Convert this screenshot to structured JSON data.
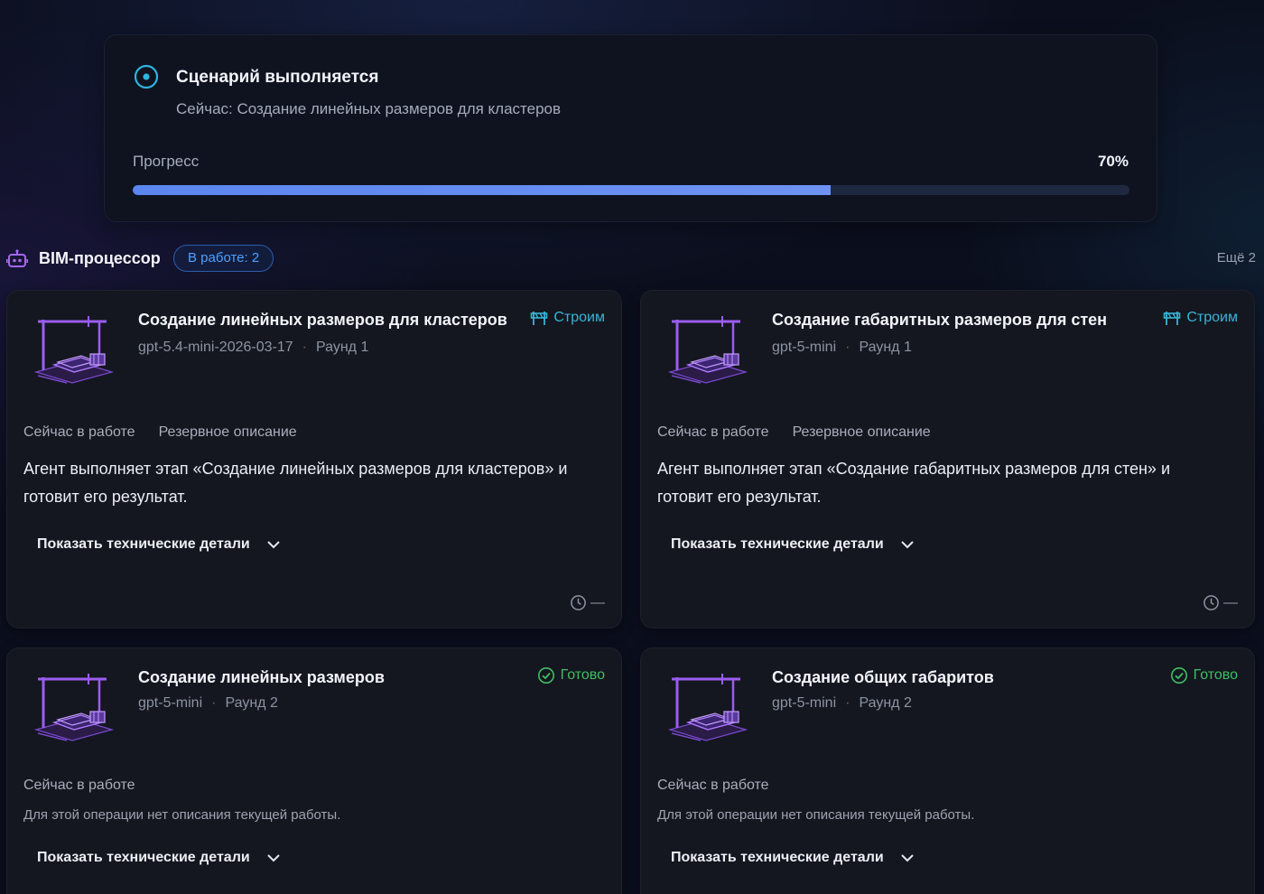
{
  "scenario": {
    "title": "Сценарий выполняется",
    "current": "Сейчас: Создание линейных размеров для кластеров",
    "progress_label": "Прогресс",
    "progress_value": "70%",
    "progress_fraction": 0.7,
    "accent": "#5b86ef"
  },
  "section": {
    "name": "BIM-процессор",
    "badge": "В работе: 2",
    "more": "Ещё 2"
  },
  "cards": [
    {
      "title": "Создание линейных размеров для кластеров",
      "model": "gpt-5.4-mini-2026-03-17",
      "dot": "·",
      "round": "Раунд 1",
      "status": "Строим",
      "status_icon": "building-icon",
      "label_now": "Сейчас в работе",
      "label_backup": "Резервное описание",
      "description": "Агент выполняет этап «Создание линейных размеров для кластеров» и готовит его результат.",
      "details": "Показать технические детали",
      "timer": "—"
    },
    {
      "title": "Создание габаритных размеров для стен",
      "model": "gpt-5-mini",
      "dot": "·",
      "round": "Раунд 1",
      "status": "Строим",
      "status_icon": "building-icon",
      "label_now": "Сейчас в работе",
      "label_backup": "Резервное описание",
      "description": "Агент выполняет этап «Создание габаритных размеров для стен» и готовит его результат.",
      "details": "Показать технические детали",
      "timer": "—"
    },
    {
      "title": "Создание линейных размеров",
      "model": "gpt-5-mini",
      "dot": "·",
      "round": "Раунд 2",
      "status": "Готово",
      "status_icon": "check-circle-icon",
      "label_now": "Сейчас в работе",
      "description": "Для этой операции нет описания текущей работы.",
      "details": "Показать технические детали"
    },
    {
      "title": "Создание общих габаритов",
      "model": "gpt-5-mini",
      "dot": "·",
      "round": "Раунд 2",
      "status": "Готово",
      "status_icon": "check-circle-icon",
      "label_now": "Сейчас в работе",
      "description": "Для этой операции нет описания текущей работы.",
      "details": "Показать технические детали"
    }
  ],
  "colors": {
    "building": "#37b5d8",
    "done": "#3fbf63",
    "badge": "#4ea1ff",
    "illustration": "#9b5cf0"
  }
}
